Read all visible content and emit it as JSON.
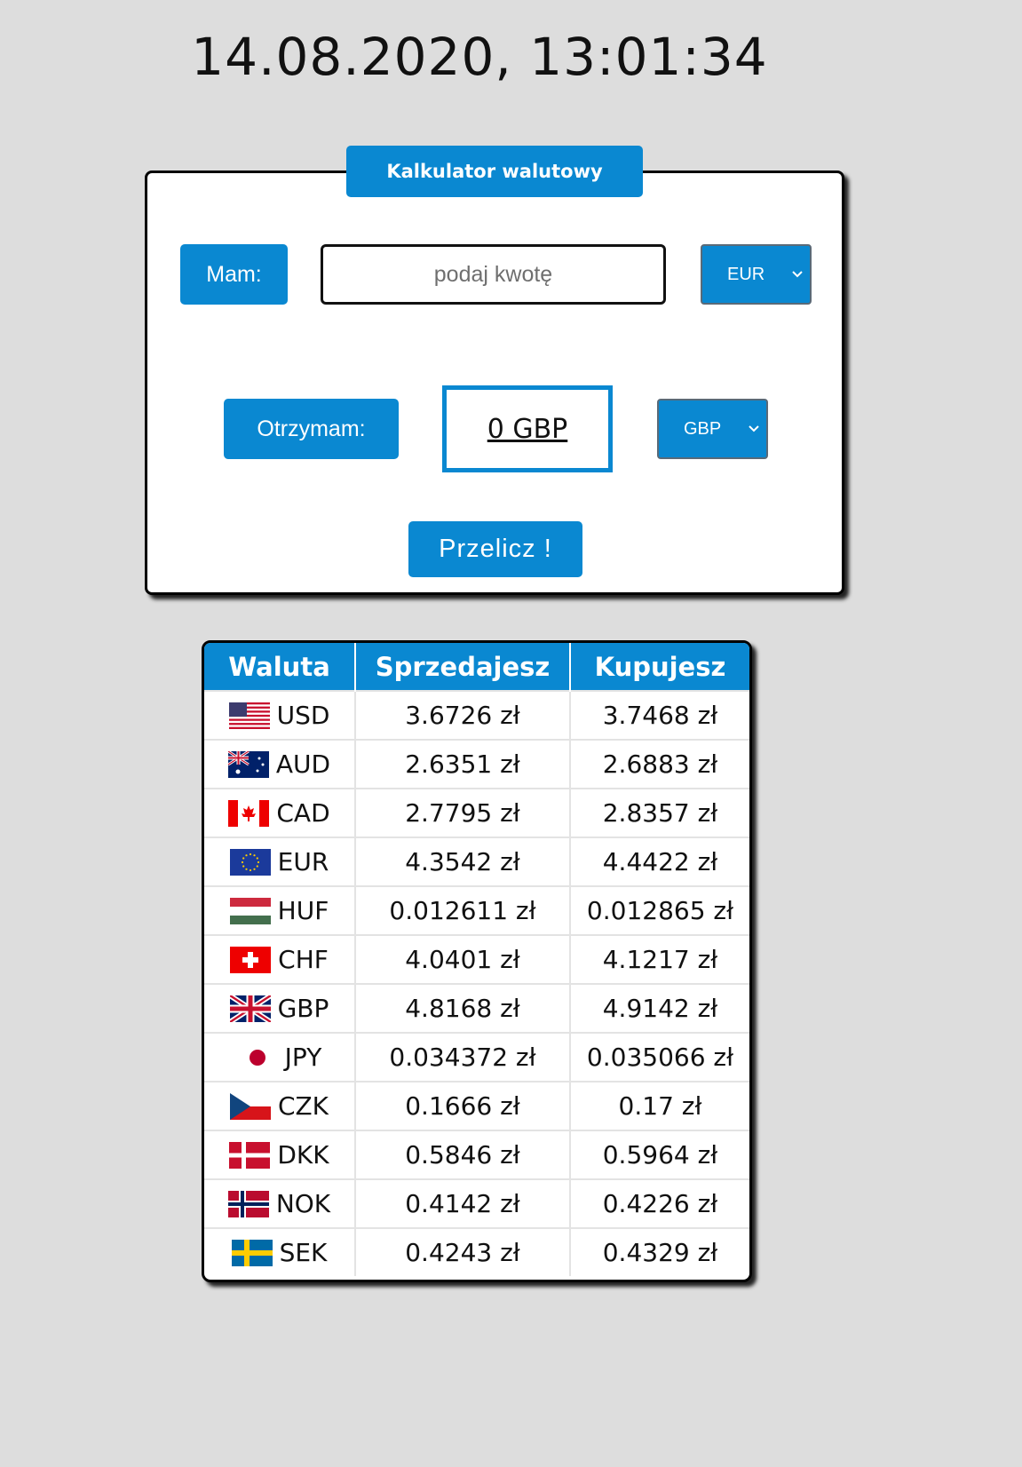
{
  "datetime": "14.08.2020, 13:01:34",
  "calculator": {
    "title": "Kalkulator walutowy",
    "have_label": "Mam:",
    "amount_placeholder": "podaj kwotę",
    "amount_value": "",
    "from_currency": "EUR",
    "receive_label": "Otrzymam:",
    "result": "0 GBP",
    "to_currency": "GBP",
    "convert_label": "Przelicz !"
  },
  "rates_table": {
    "headers": [
      "Waluta",
      "Sprzedajesz",
      "Kupujesz"
    ],
    "rows": [
      {
        "code": "USD",
        "flag": "us-flag-icon",
        "sell": "3.6726 zł",
        "buy": "3.7468 zł"
      },
      {
        "code": "AUD",
        "flag": "au-flag-icon",
        "sell": "2.6351 zł",
        "buy": "2.6883 zł"
      },
      {
        "code": "CAD",
        "flag": "ca-flag-icon",
        "sell": "2.7795 zł",
        "buy": "2.8357 zł"
      },
      {
        "code": "EUR",
        "flag": "eu-flag-icon",
        "sell": "4.3542 zł",
        "buy": "4.4422 zł"
      },
      {
        "code": "HUF",
        "flag": "hu-flag-icon",
        "sell": "0.012611 zł",
        "buy": "0.012865 zł"
      },
      {
        "code": "CHF",
        "flag": "ch-flag-icon",
        "sell": "4.0401 zł",
        "buy": "4.1217 zł"
      },
      {
        "code": "GBP",
        "flag": "gb-flag-icon",
        "sell": "4.8168 zł",
        "buy": "4.9142 zł"
      },
      {
        "code": "JPY",
        "flag": "jp-flag-icon",
        "sell": "0.034372 zł",
        "buy": "0.035066 zł"
      },
      {
        "code": "CZK",
        "flag": "cz-flag-icon",
        "sell": "0.1666 zł",
        "buy": "0.17 zł"
      },
      {
        "code": "DKK",
        "flag": "dk-flag-icon",
        "sell": "0.5846 zł",
        "buy": "0.5964 zł"
      },
      {
        "code": "NOK",
        "flag": "no-flag-icon",
        "sell": "0.4142 zł",
        "buy": "0.4226 zł"
      },
      {
        "code": "SEK",
        "flag": "se-flag-icon",
        "sell": "0.4243 zł",
        "buy": "0.4329 zł"
      }
    ]
  },
  "colors": {
    "accent": "#0a88d1",
    "background": "#dddddd"
  }
}
